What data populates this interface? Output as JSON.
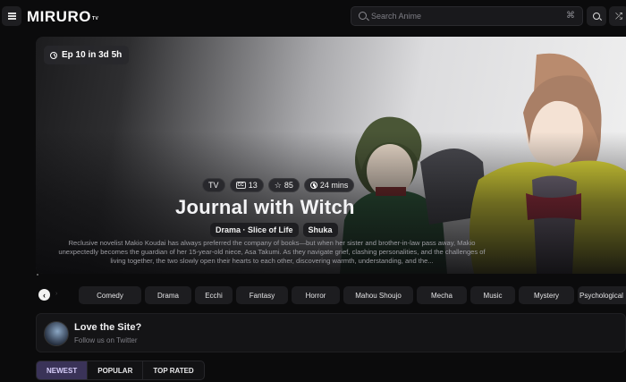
{
  "header": {
    "logo": "MIRURO",
    "logo_tm": "TV",
    "search_placeholder": "Search Anime"
  },
  "hero": {
    "next_episode": "Ep 10 in 3d 5h",
    "format": "TV",
    "episodes": "13",
    "score": "85",
    "duration": "24 mins",
    "title": "Journal with Witch",
    "genres_label": "Drama · Slice of Life",
    "studio": "Shuka",
    "synopsis": "Reclusive novelist Makio Koudai has always preferred the company of books—but when her sister and brother-in-law pass away, Makio unexpectedly becomes the guardian of her 15-year-old niece, Asa Takumi. As they navigate grief, clashing personalities, and the challenges of living together, the two slowly open their hearts to each other, discovering warmth, understanding, and the..."
  },
  "genre_bar": {
    "items": [
      "Comedy",
      "Drama",
      "Ecchi",
      "Fantasy",
      "Horror",
      "Mahou Shoujo",
      "Mecha",
      "Music",
      "Mystery",
      "Psychological"
    ]
  },
  "love_card": {
    "title": "Love the Site?",
    "subtitle": "Follow us on Twitter"
  },
  "tabs": {
    "items": [
      "NEWEST",
      "POPULAR",
      "TOP RATED"
    ],
    "active": "NEWEST"
  },
  "colors": {
    "background": "#0b0b0c",
    "active_tab": "#3a3358",
    "active_tab_text": "#d8cffb",
    "artwork_yellow": "#e8e23a"
  }
}
